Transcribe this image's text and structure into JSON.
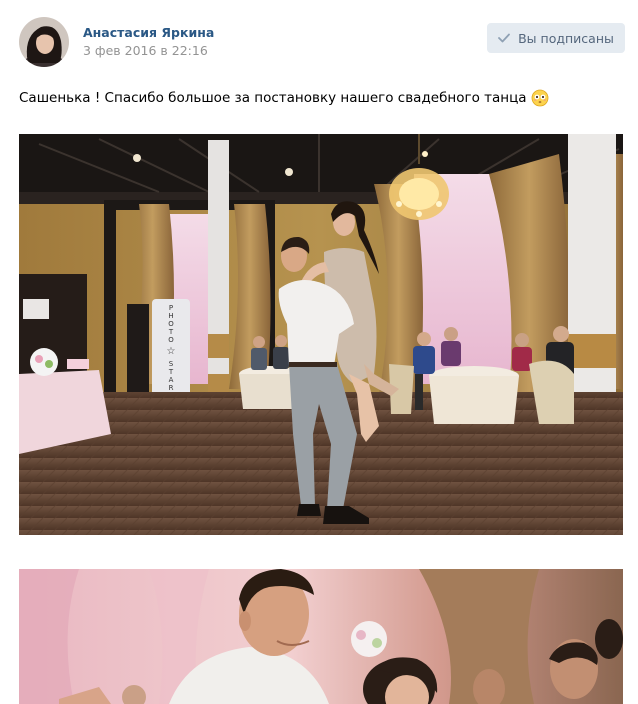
{
  "post": {
    "author": "Анастасия Яркина",
    "date": "3 фев 2016 в 22:16",
    "subscribe_button": "Вы подписаны",
    "text": "Сашенька ! Спасибо большое за постановку нашего свадебного танца",
    "emoji": "flushed-face-icon"
  },
  "photo_signs": {
    "photo_booth": [
      "P",
      "H",
      "O",
      "T",
      "O",
      "☆",
      "S",
      "T",
      "A",
      "R"
    ]
  },
  "colors": {
    "author_link": "#2a5885",
    "date": "#939393",
    "button_bg": "#e5ebf1",
    "button_text": "#55677d"
  }
}
